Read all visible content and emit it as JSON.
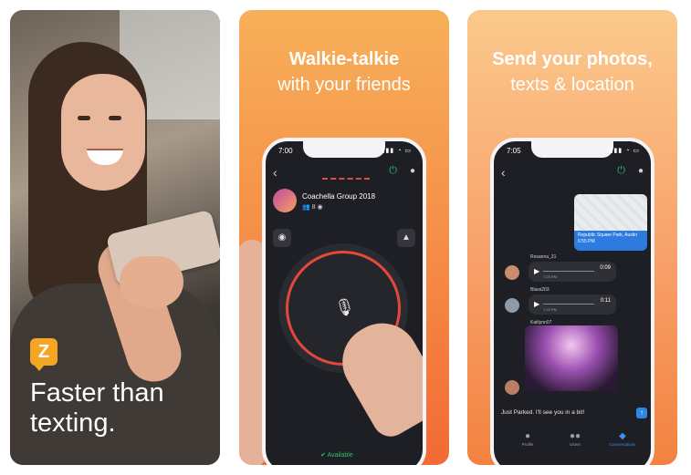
{
  "card1": {
    "tagline_line1": "Faster than",
    "tagline_line2": "texting.",
    "logo_letter": "Z"
  },
  "card2": {
    "heading_bold": "Walkie-talkie",
    "heading_regular": "with your friends",
    "phone": {
      "time": "7:00",
      "group_name": "Coachella Group 2018",
      "group_members": "8",
      "status": "Available",
      "icons": [
        "back-icon",
        "power-icon",
        "chat-icon",
        "camera-icon",
        "alert-icon",
        "microphone-icon",
        "check-icon"
      ]
    }
  },
  "card3": {
    "heading_bold": "Send your photos,",
    "heading_regular": "texts & location",
    "phone": {
      "time": "7:05",
      "map_caption": "Republic Square Park, Austin",
      "map_time": "6:55 PM",
      "messages": [
        {
          "name": "Rosanna_31",
          "duration": "0:09",
          "time": "7:23 PM"
        },
        {
          "name": "Blass203",
          "duration": "0:11",
          "time": "7:23 PM"
        },
        {
          "name": "Kaitlynn07"
        }
      ],
      "input_text": "Just Parked. I'll see you in a bit!",
      "tabs": [
        {
          "label": "Profile",
          "icon": "person-icon"
        },
        {
          "label": "Users",
          "icon": "users-icon"
        },
        {
          "label": "Conversations",
          "icon": "chat-icon"
        }
      ]
    }
  },
  "colors": {
    "accent_orange": "#f58b45",
    "accent_green": "#2fbf71",
    "accent_red": "#e5483b",
    "accent_blue": "#2d86e6"
  }
}
